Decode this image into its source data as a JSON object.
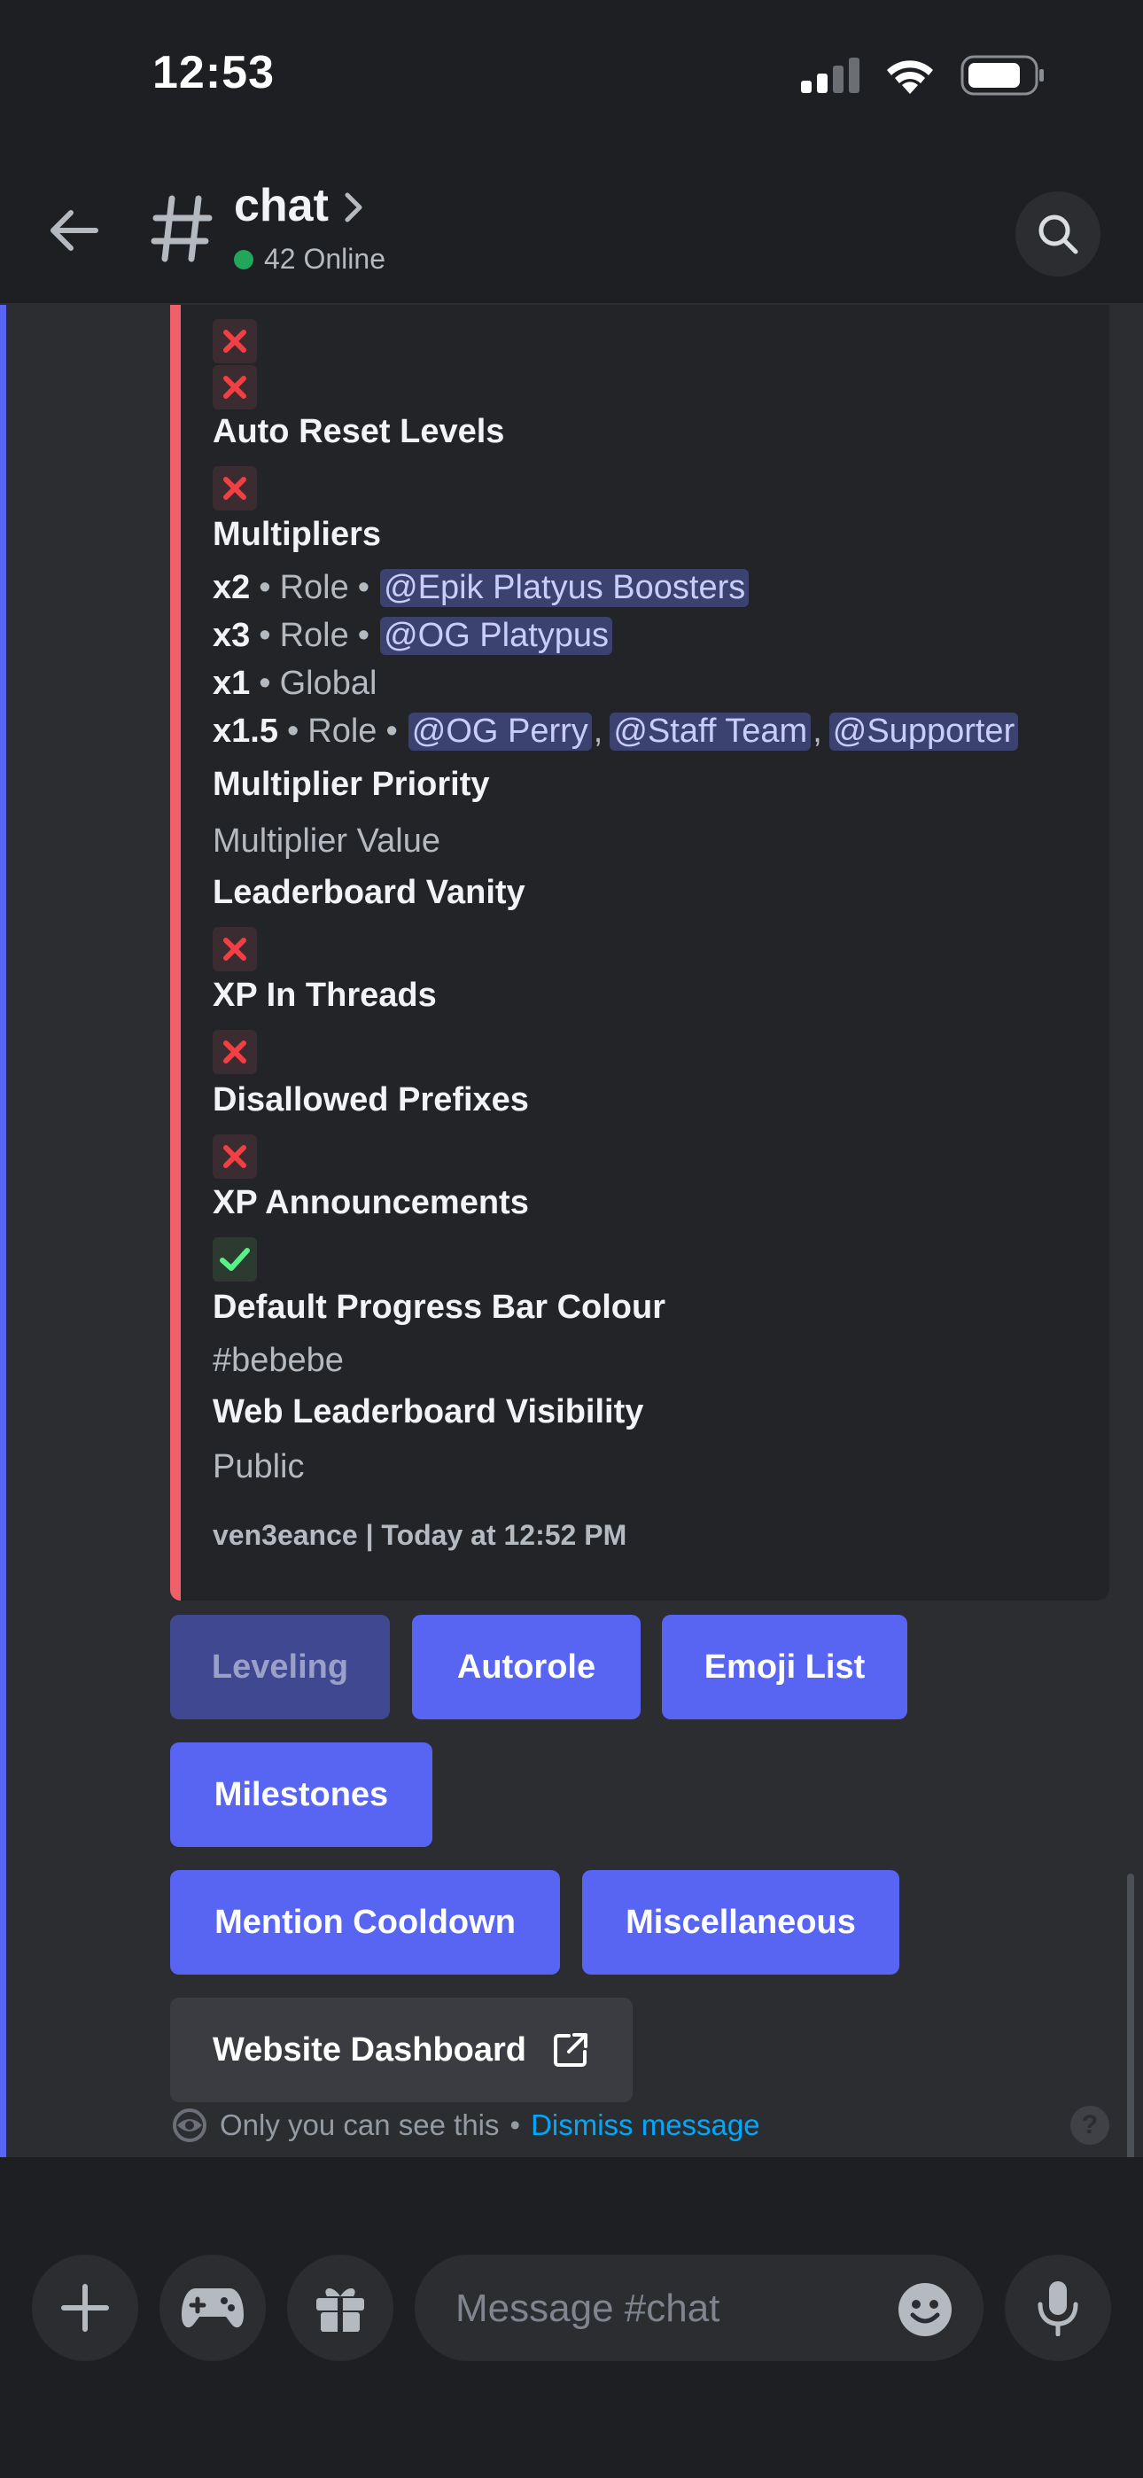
{
  "status_bar": {
    "time": "12:53"
  },
  "header": {
    "title": "chat",
    "online": "42 Online"
  },
  "embed": {
    "auto_reset_label": "Auto Reset Levels",
    "multipliers_label": "Multipliers",
    "multipliers": [
      {
        "value": "x2",
        "type": "Role",
        "mentions": [
          "@Epik Platyus Boosters"
        ]
      },
      {
        "value": "x3",
        "type": "Role",
        "mentions": [
          "@OG Platypus"
        ]
      },
      {
        "value": "x1",
        "type": "Global",
        "mentions": []
      },
      {
        "value": "x1.5",
        "type": "Role",
        "mentions": [
          "@OG Perry",
          "@Staff Team",
          "@Supporter"
        ]
      }
    ],
    "multiplier_priority_label": "Multiplier Priority",
    "multiplier_priority_value": "Multiplier Value",
    "leaderboard_vanity_label": "Leaderboard Vanity",
    "xp_threads_label": "XP In Threads",
    "disallowed_prefixes_label": "Disallowed Prefixes",
    "xp_announcements_label": "XP Announcements",
    "progress_colour_label": "Default Progress Bar Colour",
    "progress_colour_value": "#bebebe",
    "web_visibility_label": "Web Leaderboard Visibility",
    "web_visibility_value": "Public",
    "footer": "ven3eance | Today at 12:52 PM",
    "colors": {
      "accent_bar": "#f0606a",
      "x_mark": "#f23f43",
      "check_mark": "#57f287"
    }
  },
  "buttons": {
    "leveling": "Leveling",
    "autorole": "Autorole",
    "emoji_list": "Emoji List",
    "milestones": "Milestones",
    "mention_cooldown": "Mention Cooldown",
    "miscellaneous": "Miscellaneous",
    "website_dashboard": "Website Dashboard"
  },
  "ephemeral": {
    "text": "Only you can see this",
    "bullet": "•",
    "dismiss": "Dismiss message"
  },
  "composer": {
    "placeholder": "Message #chat"
  }
}
